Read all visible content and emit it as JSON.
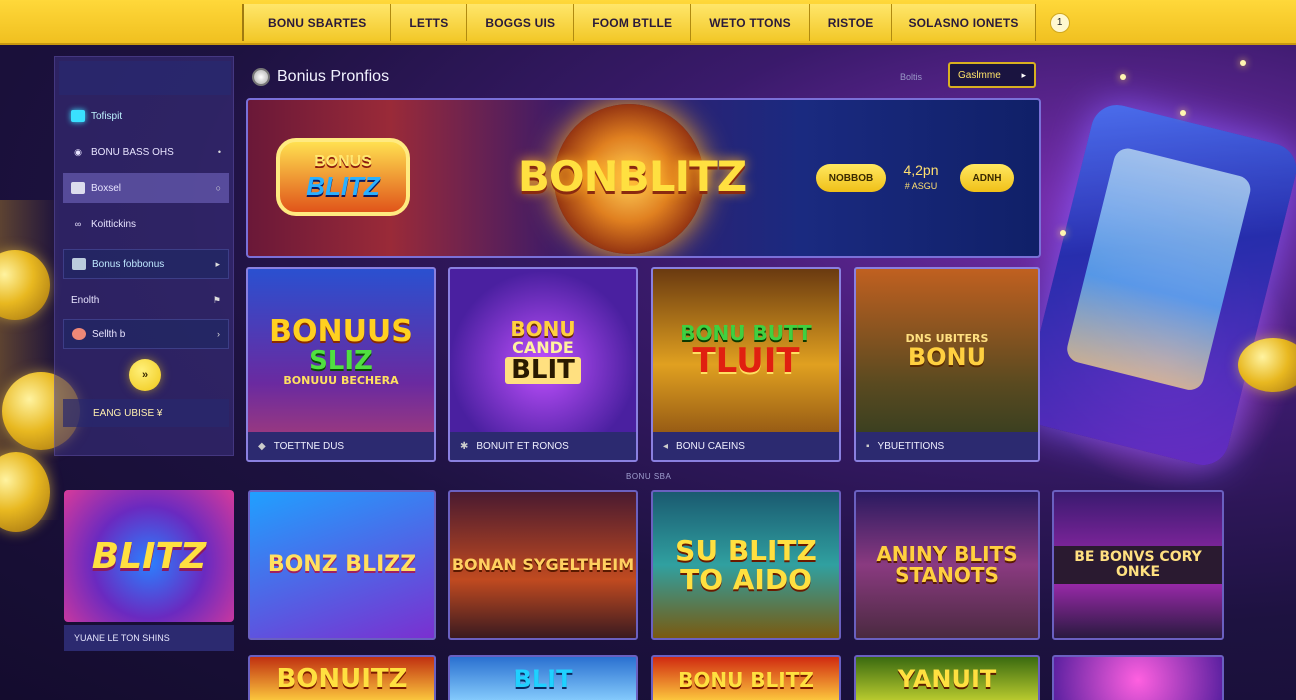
{
  "nav": {
    "items": [
      "BONU SBARTES",
      "LETTS",
      "BOGGS UIS",
      "FOOM BTLLE",
      "WETO TTONS",
      "RISTOE",
      "SOLASNO IONETS"
    ],
    "round_btn": "1"
  },
  "sidebar": {
    "items": [
      {
        "label": "Tofispit",
        "icon": "square-icon"
      },
      {
        "label": "BONU BASS OHS",
        "icon": "eye-icon"
      },
      {
        "label": "Boxsel",
        "icon": "box-icon"
      },
      {
        "label": "Koittickins",
        "icon": "link-icon"
      },
      {
        "label": "Bonus fobbonus",
        "icon": "flag-icon"
      },
      {
        "label": "Enolth",
        "icon": "flag-icon"
      },
      {
        "label": "Sellth b",
        "icon": "circle-icon"
      }
    ],
    "round_btn": "»",
    "footer": "EANG UBISE ¥"
  },
  "main": {
    "title": "Bonius Pronfios",
    "header_link": "Boltis",
    "header_button": "Gaslmme"
  },
  "hero": {
    "left_logo_top": "BONUS",
    "left_logo_bottom": "BLITZ",
    "title": "BONBLITZ",
    "pill1": "NOBBOB",
    "mid_top": "4,2pn",
    "mid_bottom": "# ASGU",
    "pill2": "ADNH"
  },
  "cards": [
    {
      "art_top": "BONUUS",
      "art_mid": "SLIZ",
      "art_bottom": "BONUUU BECHERA",
      "label": "TOETTNE DUS"
    },
    {
      "art_top": "BONU",
      "art_mid": "CANDE",
      "art_bottom": "BLIT",
      "label": "BONUIT ET RONOS"
    },
    {
      "art_top": "BONU BUTT",
      "art_mid": "TLUIT",
      "art_bottom": "",
      "label": "BONU CAEINS"
    },
    {
      "art_top": "DNS UBITERS",
      "art_mid": "BONU",
      "art_bottom": "",
      "label": "YBUETITIONS"
    }
  ],
  "row_label": "BONU SBA",
  "left_promo": {
    "title": "BLITZ",
    "label": "YUANE LE TON SHINS"
  },
  "thumbs": [
    {
      "text": "BONZ BLIZZ"
    },
    {
      "text": "BONAN SYGELTHEIM"
    },
    {
      "text": "SU BLITZ TO AIDO"
    },
    {
      "text": "ANINY BLITS STANOTS"
    },
    {
      "text": "BE BONVS CORY ONKE"
    }
  ],
  "bottom_thumbs": [
    {
      "text": "BONUITZ"
    },
    {
      "text": "BLIT"
    },
    {
      "text": "BONU BLITZ"
    },
    {
      "text": "YANUIT"
    },
    {
      "text": ""
    }
  ]
}
